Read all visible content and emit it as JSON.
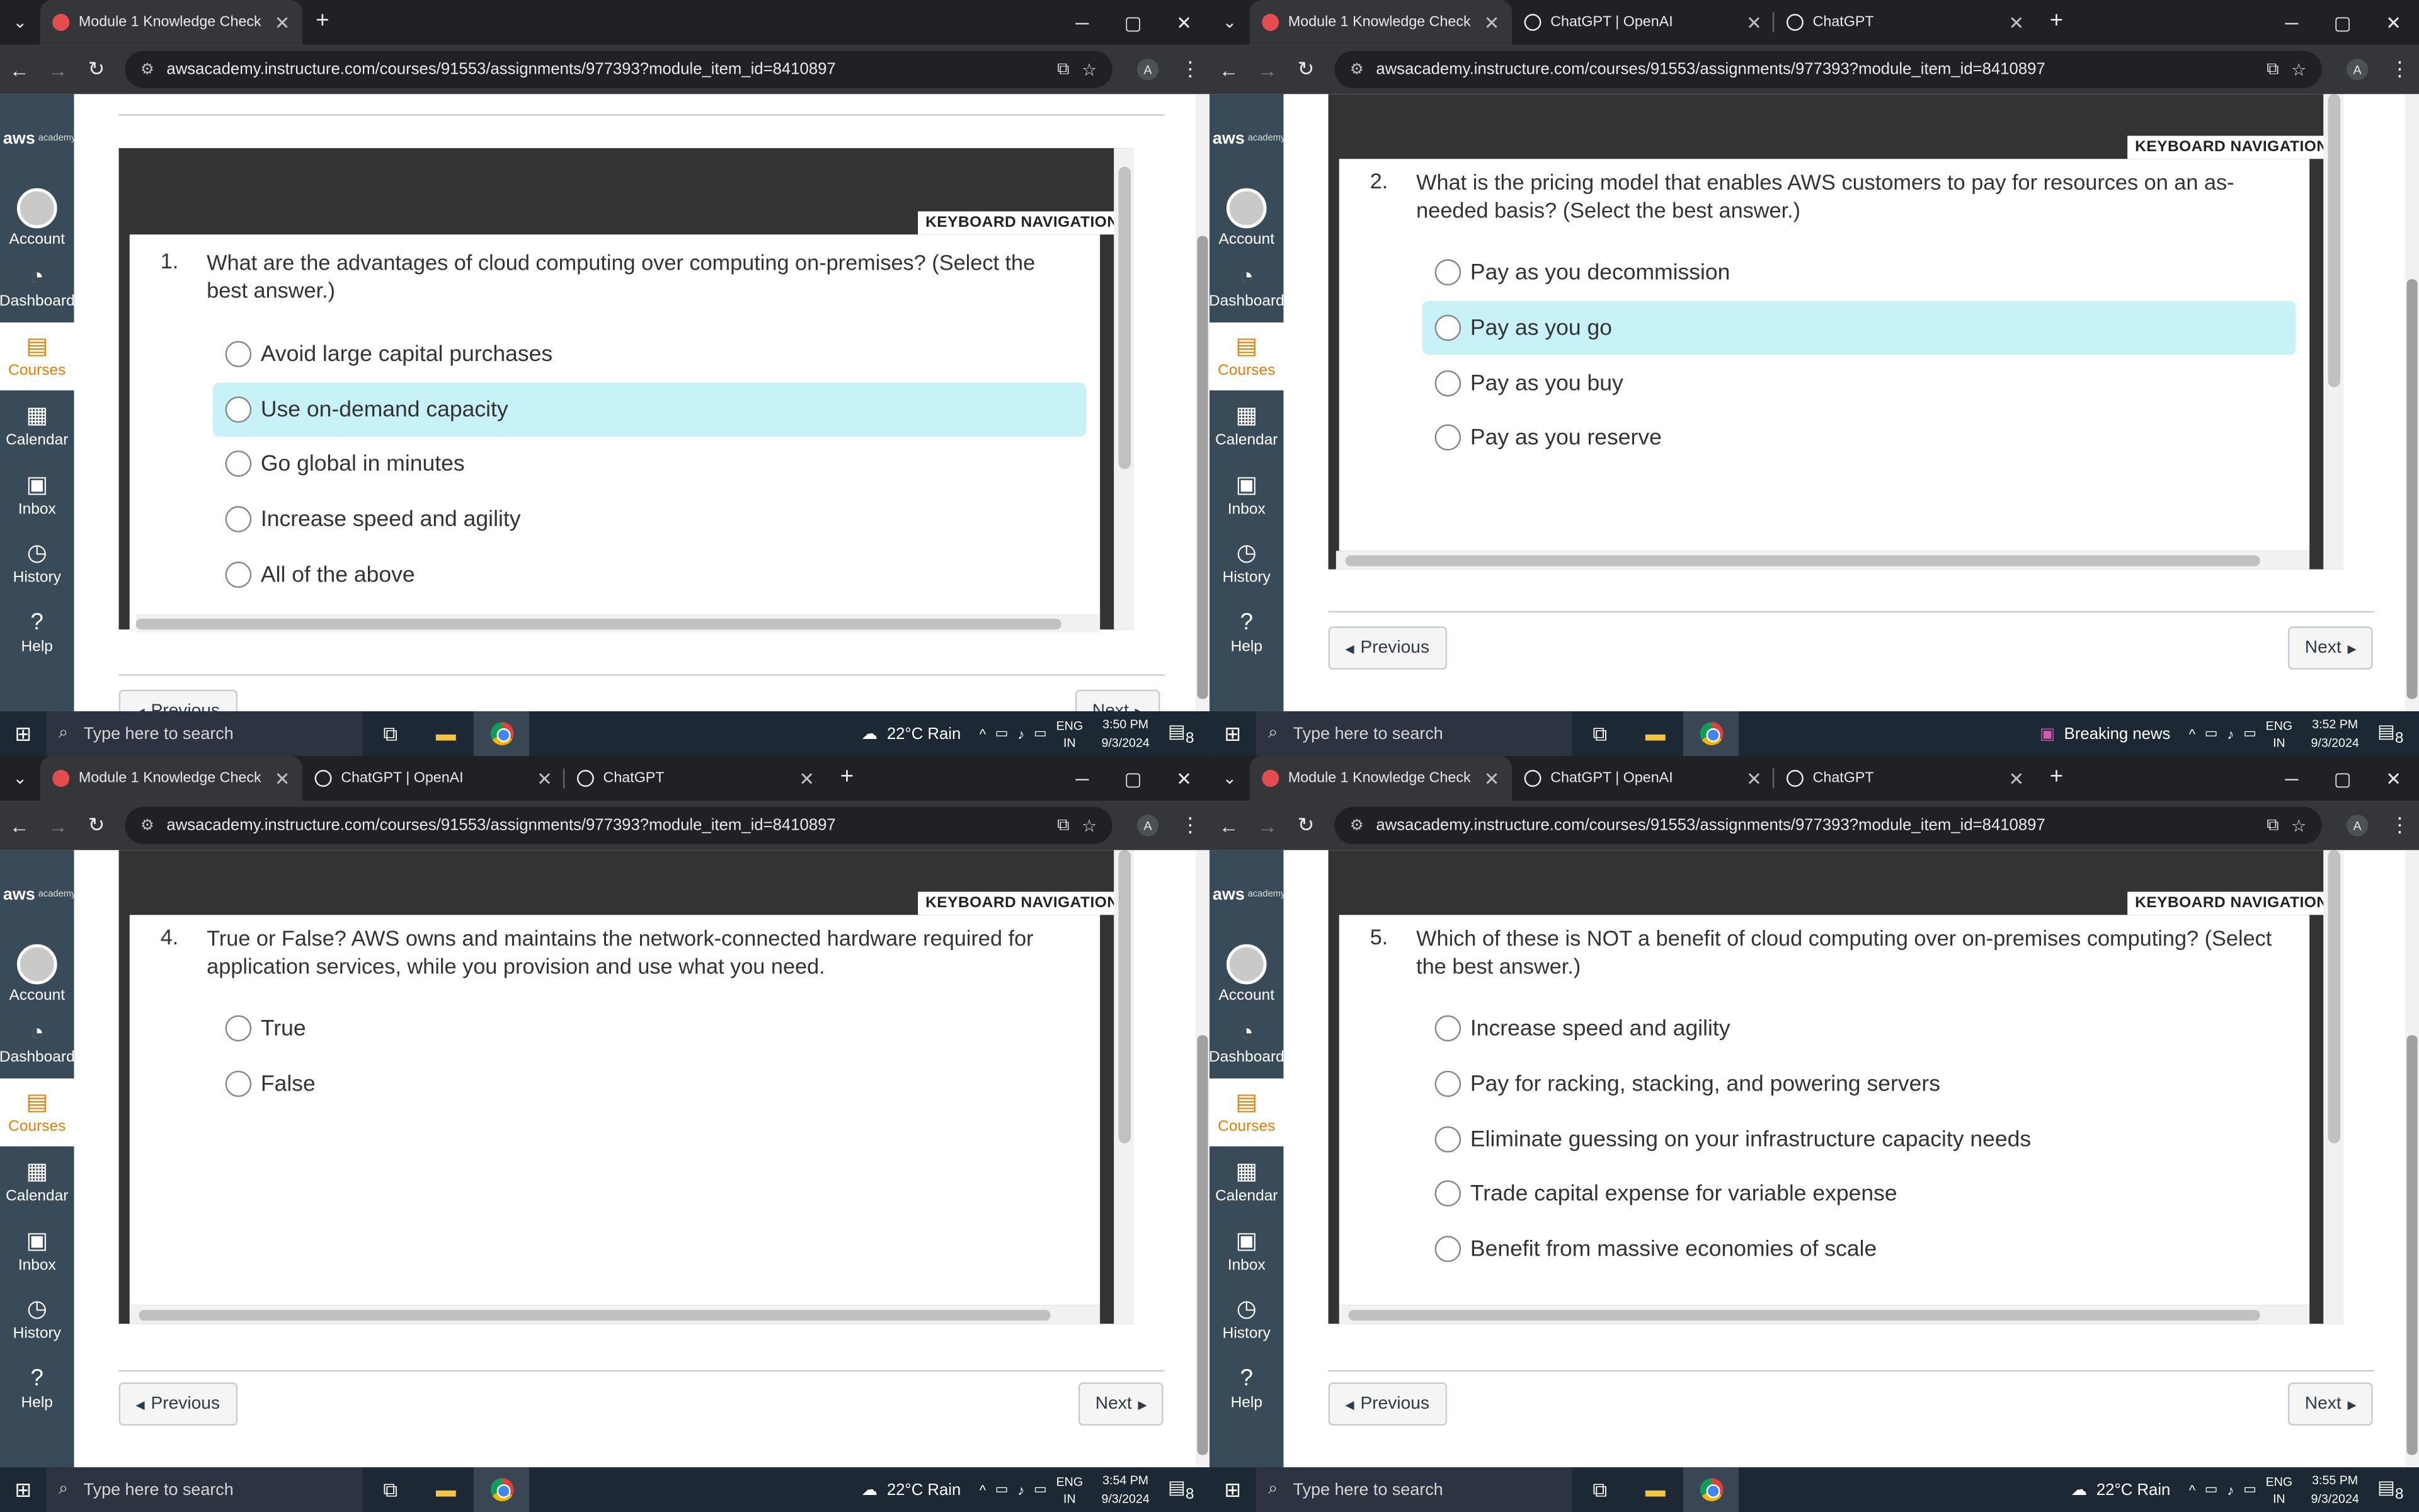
{
  "browser": {
    "url": "awsacademy.instructure.com/courses/91553/assignments/977393?module_item_id=8410897",
    "new_tab": "+",
    "win_min": "─",
    "win_max": "▢",
    "win_close": "✕",
    "tab_close": "✕",
    "profile": "A"
  },
  "tabs_single": [
    "Module 1 Knowledge Check"
  ],
  "tabs_multi": [
    "Module 1 Knowledge Check",
    "ChatGPT | OpenAI",
    "ChatGPT"
  ],
  "global_nav": {
    "logo": "aws",
    "logo_sub": "academy",
    "items": [
      "Account",
      "Dashboard",
      "Courses",
      "Calendar",
      "Inbox",
      "History",
      "Help"
    ]
  },
  "quiz": {
    "keyboard_nav": "KEYBOARD NAVIGATION",
    "previous": "Previous",
    "next": "Next",
    "q1": {
      "number": "1.",
      "text": "What are the advantages of cloud computing over computing on-premises? (Select the best answer.)",
      "options": [
        "Avoid large capital purchases",
        "Use on-demand capacity",
        "Go global in minutes",
        "Increase speed and agility",
        "All of the above"
      ],
      "highlighted": 1
    },
    "q2": {
      "number": "2.",
      "text": "What is the pricing model that enables AWS customers to pay for resources on an as-needed basis? (Select the best answer.)",
      "options": [
        "Pay as you decommission",
        "Pay as you go",
        "Pay as you buy",
        "Pay as you reserve"
      ],
      "highlighted": 1
    },
    "q4": {
      "number": "4.",
      "text": "True or False? AWS owns and maintains the network-connected hardware required for application services, while you provision and use what you need.",
      "options": [
        "True",
        "False"
      ]
    },
    "q5": {
      "number": "5.",
      "text": "Which of these is NOT a benefit of cloud computing over on-premises computing? (Select the best answer.)",
      "options": [
        "Increase speed and agility",
        "Pay for racking, stacking, and powering servers",
        "Eliminate guessing on your infrastructure capacity needs",
        "Trade capital expense for variable expense",
        "Benefit from massive economies of scale"
      ]
    }
  },
  "taskbar": {
    "search_placeholder": "Type here to search",
    "weather": "22°C  Rain",
    "news": "Breaking news",
    "lang1": "ENG",
    "lang2": "IN",
    "date": "9/3/2024",
    "notif_count": "8",
    "times": [
      "3:50 PM",
      "3:52 PM",
      "3:54 PM",
      "3:55 PM"
    ]
  }
}
